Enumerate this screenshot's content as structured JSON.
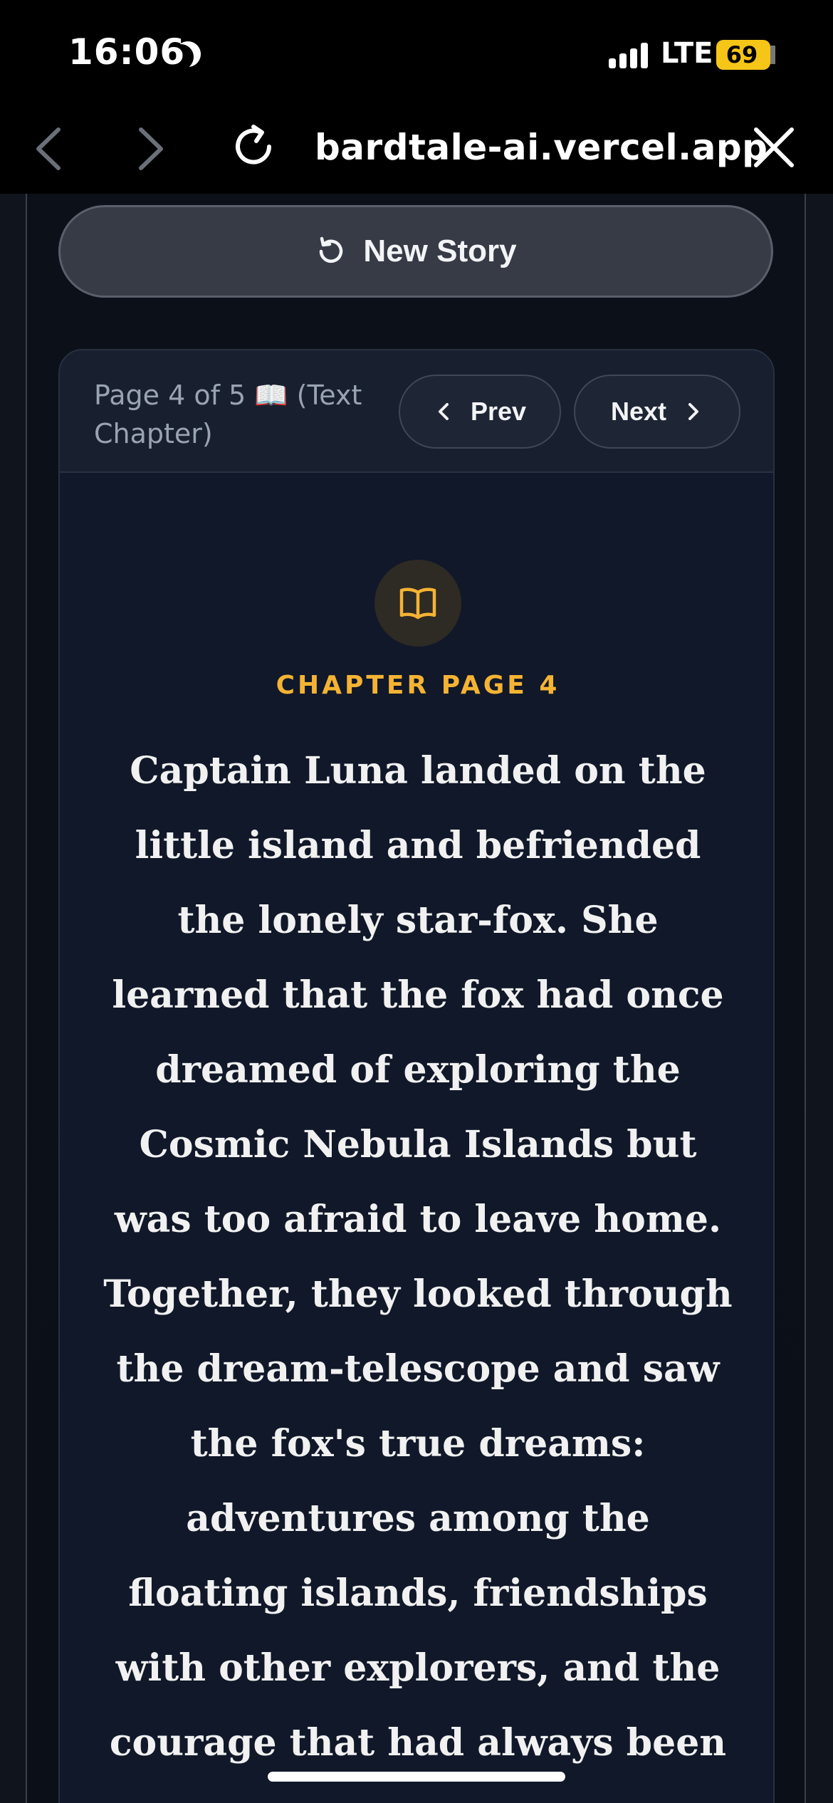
{
  "status_bar": {
    "time": "16:06",
    "network": "LTE",
    "battery": "69"
  },
  "browser": {
    "url": "bardtale-ai.vercel.app"
  },
  "toolbar": {
    "new_story_label": "New Story"
  },
  "pager": {
    "indicator": "Page 4 of 5 📖 (Text Chapter)",
    "prev_label": "Prev",
    "next_label": "Next"
  },
  "chapter": {
    "label": "CHAPTER PAGE 4",
    "text": "Captain Luna landed on the little island and befriended the lonely star-fox. She learned that the fox had once dreamed of exploring the Cosmic Nebula Islands but was too afraid to leave home. Together, they looked through the dream-telescope and saw the fox's true dreams: adventures among the floating islands, friendships with other explorers, and the courage that had always been"
  },
  "colors": {
    "accent": "#f5b333",
    "card_bg": "#101829",
    "header_bg": "#18202f",
    "button_bg": "#363b46"
  }
}
